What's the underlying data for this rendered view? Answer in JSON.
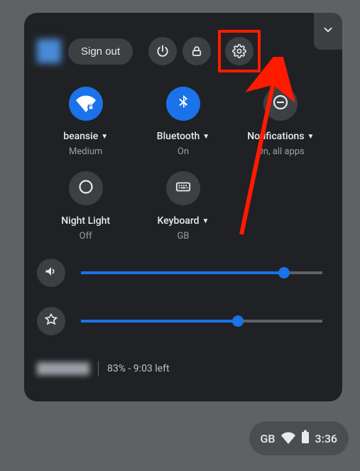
{
  "header": {
    "sign_out_label": "Sign out"
  },
  "tiles": {
    "wifi": {
      "label": "beansie",
      "sub": "Medium"
    },
    "bluetooth": {
      "label": "Bluetooth",
      "sub": "On"
    },
    "notifications": {
      "label": "Notifications",
      "sub": "On, all apps"
    },
    "night_light": {
      "label": "Night Light",
      "sub": "Off"
    },
    "keyboard": {
      "label": "Keyboard",
      "sub": "GB"
    }
  },
  "sliders": {
    "volume_percent": 84,
    "brightness_percent": 65
  },
  "footer": {
    "battery_text": "83% - 9:03 left"
  },
  "status_bar": {
    "ime": "GB",
    "time": "3:36"
  }
}
